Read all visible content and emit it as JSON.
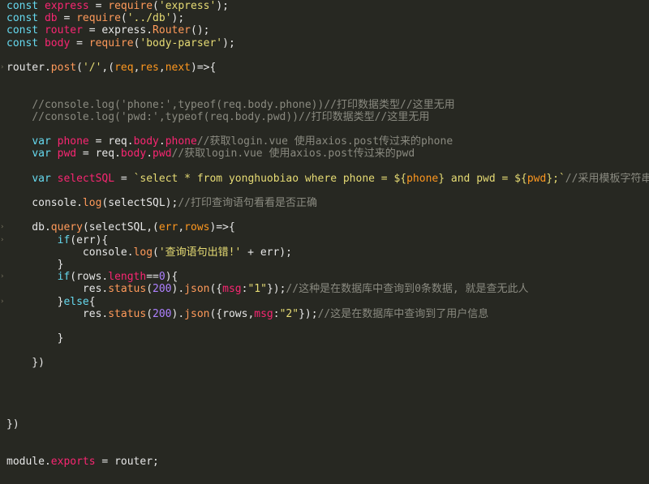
{
  "editor": {
    "language": "javascript",
    "lines": [
      [
        [
          "kw",
          "const"
        ],
        [
          "p",
          " "
        ],
        [
          "decl",
          "express"
        ],
        [
          "p",
          " = "
        ],
        [
          "fn",
          "require"
        ],
        [
          "p",
          "("
        ],
        [
          "str",
          "'express'"
        ],
        [
          "p",
          ");"
        ]
      ],
      [
        [
          "kw",
          "const"
        ],
        [
          "p",
          " "
        ],
        [
          "decl",
          "db"
        ],
        [
          "p",
          " = "
        ],
        [
          "fn",
          "require"
        ],
        [
          "p",
          "("
        ],
        [
          "str",
          "'../db'"
        ],
        [
          "p",
          ");"
        ]
      ],
      [
        [
          "kw",
          "const"
        ],
        [
          "p",
          " "
        ],
        [
          "decl",
          "router"
        ],
        [
          "p",
          " = "
        ],
        [
          "p",
          "express."
        ],
        [
          "fn",
          "Router"
        ],
        [
          "p",
          "();"
        ]
      ],
      [
        [
          "kw",
          "const"
        ],
        [
          "p",
          " "
        ],
        [
          "decl",
          "body"
        ],
        [
          "p",
          " = "
        ],
        [
          "fn",
          "require"
        ],
        [
          "p",
          "("
        ],
        [
          "str",
          "'body-parser'"
        ],
        [
          "p",
          ");"
        ]
      ],
      [],
      [
        [
          "p",
          "router."
        ],
        [
          "fn",
          "post"
        ],
        [
          "p",
          "("
        ],
        [
          "str",
          "'/'"
        ],
        [
          "p",
          ",("
        ],
        [
          "param",
          "req"
        ],
        [
          "p",
          ","
        ],
        [
          "param",
          "res"
        ],
        [
          "p",
          ","
        ],
        [
          "param",
          "next"
        ],
        [
          "p",
          ")=>{"
        ]
      ],
      [],
      [],
      [
        [
          "p",
          "    "
        ],
        [
          "cm",
          "//console.log('phone:',typeof(req.body.phone))//打印数据类型//这里无用"
        ]
      ],
      [
        [
          "p",
          "    "
        ],
        [
          "cm",
          "//console.log('pwd:',typeof(req.body.pwd))//打印数据类型//这里无用"
        ]
      ],
      [],
      [
        [
          "p",
          "    "
        ],
        [
          "kw",
          "var"
        ],
        [
          "p",
          " "
        ],
        [
          "decl",
          "phone"
        ],
        [
          "p",
          " = req."
        ],
        [
          "prop",
          "body"
        ],
        [
          "p",
          "."
        ],
        [
          "prop",
          "phone"
        ],
        [
          "cm",
          "//获取login.vue 使用axios.post传过来的phone"
        ]
      ],
      [
        [
          "p",
          "    "
        ],
        [
          "kw",
          "var"
        ],
        [
          "p",
          " "
        ],
        [
          "decl",
          "pwd"
        ],
        [
          "p",
          " = req."
        ],
        [
          "prop",
          "body"
        ],
        [
          "p",
          "."
        ],
        [
          "prop",
          "pwd"
        ],
        [
          "cm",
          "//获取login.vue 使用axios.post传过来的pwd"
        ]
      ],
      [],
      [
        [
          "p",
          "    "
        ],
        [
          "kw",
          "var"
        ],
        [
          "p",
          " "
        ],
        [
          "decl",
          "selectSQL"
        ],
        [
          "p",
          " = "
        ],
        [
          "str",
          "`select * from yonghuobiao where phone = ${"
        ],
        [
          "param",
          "phone"
        ],
        [
          "str",
          "} and pwd = ${"
        ],
        [
          "param",
          "pwd"
        ],
        [
          "str",
          "};`"
        ],
        [
          "cm",
          "//采用模板字符串"
        ]
      ],
      [],
      [
        [
          "p",
          "    console."
        ],
        [
          "fn",
          "log"
        ],
        [
          "p",
          "(selectSQL);"
        ],
        [
          "cm",
          "//打印查询语句看看是否正确"
        ]
      ],
      [],
      [
        [
          "p",
          "    db."
        ],
        [
          "fn",
          "query"
        ],
        [
          "p",
          "(selectSQL,("
        ],
        [
          "param",
          "err"
        ],
        [
          "p",
          ","
        ],
        [
          "param",
          "rows"
        ],
        [
          "p",
          ")=>{"
        ]
      ],
      [
        [
          "p",
          "        "
        ],
        [
          "kw",
          "if"
        ],
        [
          "p",
          "(err){"
        ]
      ],
      [
        [
          "p",
          "            console."
        ],
        [
          "fn",
          "log"
        ],
        [
          "p",
          "("
        ],
        [
          "str",
          "'查询语句出错!'"
        ],
        [
          "p",
          " + err);"
        ]
      ],
      [
        [
          "p",
          "        }"
        ]
      ],
      [
        [
          "p",
          "        "
        ],
        [
          "kw",
          "if"
        ],
        [
          "p",
          "(rows."
        ],
        [
          "prop",
          "length"
        ],
        [
          "p",
          "=="
        ],
        [
          "num",
          "0"
        ],
        [
          "p",
          "){"
        ]
      ],
      [
        [
          "p",
          "            res."
        ],
        [
          "fn",
          "status"
        ],
        [
          "p",
          "("
        ],
        [
          "num",
          "200"
        ],
        [
          "p",
          ")."
        ],
        [
          "fn",
          "json"
        ],
        [
          "p",
          "({"
        ],
        [
          "prop",
          "msg"
        ],
        [
          "p",
          ":"
        ],
        [
          "str",
          "\"1\""
        ],
        [
          "p",
          "});"
        ],
        [
          "cm",
          "//这种是在数据库中查询到0条数据, 就是查无此人"
        ]
      ],
      [
        [
          "p",
          "        }"
        ],
        [
          "kw",
          "else"
        ],
        [
          "p",
          "{"
        ]
      ],
      [
        [
          "p",
          "            res."
        ],
        [
          "fn",
          "status"
        ],
        [
          "p",
          "("
        ],
        [
          "num",
          "200"
        ],
        [
          "p",
          ")."
        ],
        [
          "fn",
          "json"
        ],
        [
          "p",
          "({rows,"
        ],
        [
          "prop",
          "msg"
        ],
        [
          "p",
          ":"
        ],
        [
          "str",
          "\"2\""
        ],
        [
          "p",
          "});"
        ],
        [
          "cm",
          "//这是在数据库中查询到了用户信息"
        ]
      ],
      [],
      [
        [
          "p",
          "        }"
        ]
      ],
      [],
      [
        [
          "p",
          "    })"
        ]
      ],
      [],
      [],
      [],
      [],
      [
        [
          "p",
          "})"
        ]
      ],
      [],
      [],
      [
        [
          "p",
          "module."
        ],
        [
          "prop",
          "exports"
        ],
        [
          "p",
          " = router;"
        ]
      ],
      []
    ]
  }
}
